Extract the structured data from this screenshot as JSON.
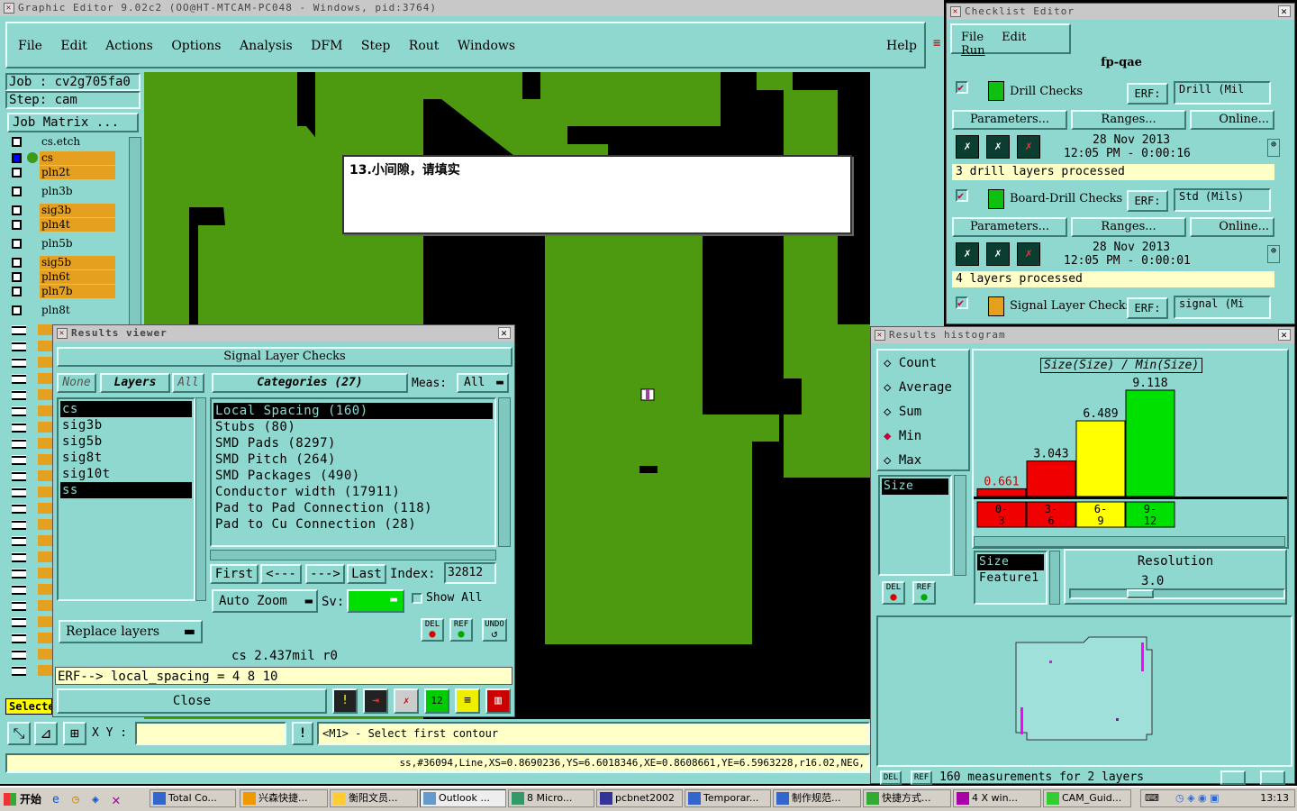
{
  "graphic_editor": {
    "title": "Graphic Editor 9.02c2  (OO@HT-MTCAM-PC048 - Windows, pid:3764)",
    "menu": [
      "File",
      "Edit",
      "Actions",
      "Options",
      "Analysis",
      "DFM",
      "Step",
      "Rout",
      "Windows"
    ],
    "help": "Help",
    "job": "Job : cv2g705fa0",
    "step": "Step: cam",
    "job_matrix": "Job Matrix ...",
    "layers": [
      {
        "name": "cs.etch",
        "color": "teal"
      },
      {
        "name": "cs",
        "color": "orange"
      },
      {
        "name": "pln2t",
        "color": "orange"
      },
      {
        "name": "pln3b",
        "color": "teal"
      },
      {
        "name": "sig3b",
        "color": "orange"
      },
      {
        "name": "pln4t",
        "color": "orange"
      },
      {
        "name": "pln5b",
        "color": "teal"
      },
      {
        "name": "sig5b",
        "color": "orange"
      },
      {
        "name": "pln6t",
        "color": "orange"
      },
      {
        "name": "pln7b",
        "color": "orange"
      },
      {
        "name": "pln8t",
        "color": "teal"
      }
    ],
    "note_text": "13.小间隙，请填实",
    "select_label": "Selecte",
    "xy_label": "X Y :",
    "prompt": "<M1> - Select first contour",
    "status_line": "ss,#36094,Line,XS=0.8690236,YS=6.6018346,XE=0.8608661,YE=6.5963228,r16.02,NEG,"
  },
  "checklist_editor": {
    "title": "Checklist Editor",
    "menu": [
      "File",
      "Edit",
      "Run"
    ],
    "checklist_name": "fp-qae",
    "checks": [
      {
        "name": "Drill Checks",
        "erf": "ERF:",
        "erf_value": "Drill (Mil",
        "date": "28 Nov 2013",
        "time": "12:05 PM - 0:00:16",
        "status": "3 drill layers processed"
      },
      {
        "name": "Board-Drill Checks",
        "erf": "ERF:",
        "erf_value": "Std (Mils)",
        "date": "28 Nov 2013",
        "time": "12:05 PM - 0:00:01",
        "status": "4 layers processed"
      },
      {
        "name": "Signal Layer Checks",
        "erf": "ERF:",
        "erf_value": "signal (Mi"
      }
    ],
    "param_buttons": [
      "Parameters...",
      "Ranges...",
      "Online..."
    ]
  },
  "results_viewer": {
    "title": "Results viewer",
    "header": "Signal Layer Checks",
    "none_btn": "None",
    "layers_btn": "Layers",
    "all_btn": "All",
    "categories_label": "Categories (27)",
    "meas_label": "Meas:",
    "meas_value": "All",
    "layers": [
      "cs",
      "sig3b",
      "sig5b",
      "sig8t",
      "sig10t",
      "ss"
    ],
    "categories": [
      "Local Spacing (160)",
      "Stubs (80)",
      "SMD Pads (8297)",
      "SMD Pitch (264)",
      "SMD Packages (490)",
      "Conductor width (17911)",
      "Pad to Pad Connection (118)",
      "Pad to Cu Connection (28)"
    ],
    "nav": [
      "First",
      "<---",
      "--->",
      "Last"
    ],
    "index_label": "Index:",
    "index_value": "32812",
    "auto_zoom": "Auto Zoom",
    "sv_label": "Sv:",
    "show_all": "Show All",
    "replace_layers": "Replace layers",
    "del": "DEL",
    "ref": "REF",
    "undo": "UNDO",
    "measure_line": "cs 2.437mil  r0",
    "erf_line": "ERF--> local_spacing = 4 8 10",
    "close": "Close"
  },
  "histogram": {
    "title": "Results histogram",
    "modes": [
      "Count",
      "Average",
      "Sum",
      "Min",
      "Max"
    ],
    "selected_mode": "Min",
    "size_item": "Size",
    "chart_title": "Size(Size) / Min(Size)",
    "list2": [
      "Size",
      "Feature1"
    ],
    "resolution_label": "Resolution",
    "resolution_value": "3.0",
    "footer": "160 measurements for 2 layers",
    "del": "DEL",
    "ref": "REF"
  },
  "chart_data": {
    "type": "bar",
    "title": "Size(Size) / Min(Size)",
    "categories": [
      "0-3",
      "3-6",
      "6-9",
      "9-12"
    ],
    "values": [
      0.661,
      3.043,
      6.489,
      9.118
    ],
    "colors": [
      "#f00000",
      "#f00000",
      "#ffff00",
      "#00e000"
    ],
    "ylim": [
      0,
      9.118
    ]
  },
  "taskbar": {
    "start": "开始",
    "items": [
      "Total Co...",
      "兴森快捷...",
      "衡阳文员...",
      "Outlook ...",
      "8 Micro...",
      "pcbnet2002",
      "Temporar...",
      "制作规范...",
      "快捷方式...",
      "4 X win...",
      "CAM_Guid..."
    ],
    "clock": "13:13"
  }
}
